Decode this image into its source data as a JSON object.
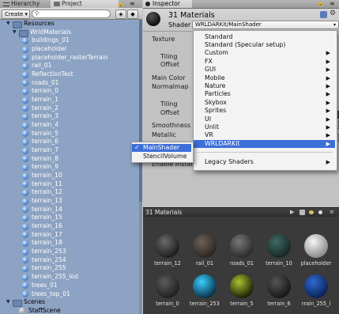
{
  "left_tabs": [
    "Hierarchy",
    "Project"
  ],
  "create_label": "Create ▾",
  "tree": {
    "resources": "Resources",
    "wrld": "WrldMaterials",
    "items": [
      "buildings_01",
      "placeholder",
      "placeholder_rasterTerrain",
      "rail_01",
      "ReflectionTest",
      "roads_01",
      "terrain_0",
      "terrain_1",
      "terrain_2",
      "terrain_3",
      "terrain_4",
      "terrain_5",
      "terrain_6",
      "terrain_7",
      "terrain_8",
      "terrain_9",
      "terrain_10",
      "terrain_11",
      "terrain_12",
      "terrain_13",
      "terrain_14",
      "terrain_15",
      "terrain_16",
      "terrain_17",
      "terrain_18",
      "terrain_253",
      "terrain_254",
      "terrain_255",
      "terrain_255_lod",
      "trees_01",
      "trees_top_01"
    ],
    "scenes": "Scenes",
    "last": "StaffScene"
  },
  "inspector": {
    "tab": "Inspector",
    "material_title": "31 Materials",
    "shader_label": "Shader",
    "shader_value": "WRLDARKit/MainShader",
    "props": {
      "texture": "Texture",
      "tiling1": "Tiling",
      "offset1": "Offset",
      "main_color": "Main Color",
      "normalmap": "Normalmap",
      "tiling2": "Tiling",
      "offset2": "Offset",
      "smoothness": "Smoothness",
      "metallic": "Metallic",
      "enable_instancing": "Enable Instanc"
    }
  },
  "shader_menu": {
    "items": [
      {
        "label": "Standard",
        "sub": false
      },
      {
        "label": "Standard (Specular setup)",
        "sub": false
      },
      {
        "label": "Custom",
        "sub": true
      },
      {
        "label": "FX",
        "sub": true
      },
      {
        "label": "GUI",
        "sub": true
      },
      {
        "label": "Mobile",
        "sub": true
      },
      {
        "label": "Nature",
        "sub": true
      },
      {
        "label": "Particles",
        "sub": true
      },
      {
        "label": "Skybox",
        "sub": true
      },
      {
        "label": "Sprites",
        "sub": true
      },
      {
        "label": "UI",
        "sub": true
      },
      {
        "label": "Unlit",
        "sub": true
      },
      {
        "label": "VR",
        "sub": true
      },
      {
        "label": "WRLDARKit",
        "sub": true,
        "selected": true
      },
      {
        "label": "Legacy Shaders",
        "sub": true
      }
    ],
    "submenu": {
      "items": [
        {
          "label": "MainShader",
          "selected": true,
          "checked": true
        },
        {
          "label": "StencilVolume"
        }
      ]
    },
    "arrow_glyph": "▶",
    "check_glyph": "✓"
  },
  "preview": {
    "title": "31 Materials",
    "row1": [
      "terrain_12",
      "rail_01",
      "roads_01",
      "terrain_10",
      "placeholder"
    ],
    "row2": [
      "terrain_0",
      "terrain_253",
      "terrain_5",
      "terrain_6",
      "rrain_255_l"
    ]
  },
  "colors": {
    "selection": "#3d6fd9",
    "project_bg": "#8da3c3"
  }
}
